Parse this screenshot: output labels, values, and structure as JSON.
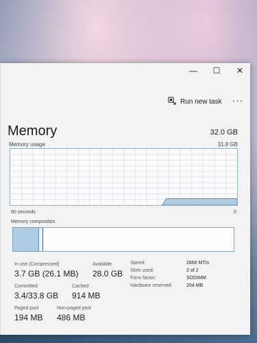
{
  "window": {
    "controls": {
      "minimize": "—",
      "maximize": "☐",
      "close": "✕"
    }
  },
  "toolbar": {
    "run_new_task": "Run new task",
    "run_icon": "run-task-icon",
    "more_icon": "more-icon",
    "more_label": "···"
  },
  "memory": {
    "title": "Memory",
    "total": "32.0 GB",
    "usage_label": "Memory usage",
    "usage_max": "31.8 GB",
    "axis_left": "60 seconds",
    "axis_right": "0",
    "composition_label": "Memory composition",
    "in_use_fraction": 0.116,
    "modified_fraction": 0.004,
    "standby_fraction": 0.01,
    "usage_level_fraction": 0.116
  },
  "stats": {
    "in_use": {
      "label": "In use (Compressed)",
      "value": "3.7 GB (26.1 MB)"
    },
    "available": {
      "label": "Available",
      "value": "28.0 GB"
    },
    "committed": {
      "label": "Committed",
      "value": "3.4/33.8 GB"
    },
    "cached": {
      "label": "Cached",
      "value": "914 MB"
    },
    "paged_pool": {
      "label": "Paged pool",
      "value": "194 MB"
    },
    "non_paged_pool": {
      "label": "Non-paged pool",
      "value": "486 MB"
    }
  },
  "specs": [
    {
      "key": "Speed:",
      "value": "2666 MT/s"
    },
    {
      "key": "Slots used:",
      "value": "2 of 2"
    },
    {
      "key": "Form factor:",
      "value": "SODIMM"
    },
    {
      "key": "Hardware reserved:",
      "value": "204 MB"
    }
  ],
  "colors": {
    "graph_border": "#8fb0c7",
    "graph_fill": "#aecde5",
    "graph_line": "#5d90b8",
    "grid": "#dde3ea"
  }
}
